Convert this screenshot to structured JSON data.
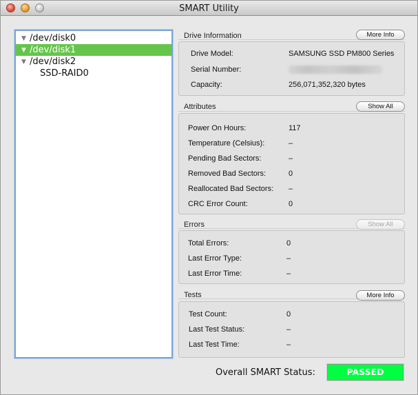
{
  "window": {
    "title": "SMART Utility"
  },
  "disks": [
    {
      "label": "/dev/disk0",
      "expander": "▼",
      "selected": false
    },
    {
      "label": "/dev/disk1",
      "expander": "▼",
      "selected": true
    },
    {
      "label": "/dev/disk2",
      "expander": "▼",
      "selected": false
    },
    {
      "label": "SSD-RAID0",
      "expander": "",
      "selected": false
    }
  ],
  "drive_info": {
    "section_label": "Drive Information",
    "more_info_button": "More Info",
    "model_label": "Drive Model:",
    "model_value": "SAMSUNG SSD PM800 Series",
    "serial_label": "Serial Number:",
    "capacity_label": "Capacity:",
    "capacity_value": "256,071,352,320 bytes"
  },
  "attributes": {
    "section_label": "Attributes",
    "show_all_button": "Show All",
    "rows": [
      {
        "label": "Power On Hours:",
        "value": "117"
      },
      {
        "label": "Temperature (Celsius):",
        "value": "–"
      },
      {
        "label": "Pending Bad Sectors:",
        "value": "–"
      },
      {
        "label": "Removed Bad Sectors:",
        "value": "0"
      },
      {
        "label": "Reallocated Bad Sectors:",
        "value": "–"
      },
      {
        "label": "CRC Error Count:",
        "value": "0"
      }
    ]
  },
  "errors": {
    "section_label": "Errors",
    "show_all_button": "Show All",
    "rows": [
      {
        "label": "Total Errors:",
        "value": "0"
      },
      {
        "label": "Last Error Type:",
        "value": "–"
      },
      {
        "label": "Last Error Time:",
        "value": "–"
      }
    ]
  },
  "tests": {
    "section_label": "Tests",
    "more_info_button": "More Info",
    "rows": [
      {
        "label": "Test Count:",
        "value": "0"
      },
      {
        "label": "Last Test Status:",
        "value": "–"
      },
      {
        "label": "Last Test Time:",
        "value": "–"
      }
    ]
  },
  "status": {
    "label": "Overall SMART Status:",
    "value": "PASSED",
    "color": "#00ff42"
  }
}
